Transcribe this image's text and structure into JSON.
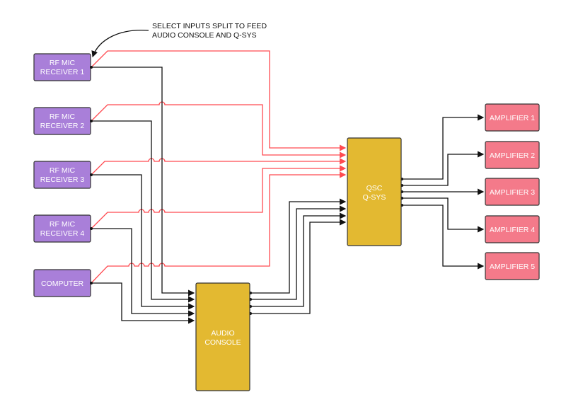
{
  "annotation": {
    "line1": "SELECT INPUTS SPLIT TO FEED",
    "line2": "AUDIO CONSOLE AND Q-SYS"
  },
  "sources": [
    {
      "line1": "RF MIC",
      "line2": "RECEIVER 1"
    },
    {
      "line1": "RF MIC",
      "line2": "RECEIVER 2"
    },
    {
      "line1": "RF MIC",
      "line2": "RECEIVER 3"
    },
    {
      "line1": "RF MIC",
      "line2": "RECEIVER 4"
    },
    {
      "line1": "COMPUTER"
    }
  ],
  "audio_console": {
    "line1": "AUDIO",
    "line2": "CONSOLE"
  },
  "qsys": {
    "line1": "QSC",
    "line2": "Q-SYS"
  },
  "amplifiers": [
    {
      "label": "AMPLIFIER 1"
    },
    {
      "label": "AMPLIFIER 2"
    },
    {
      "label": "AMPLIFIER 3"
    },
    {
      "label": "AMPLIFIER 4"
    },
    {
      "label": "AMPLIFIER 5"
    }
  ],
  "colors": {
    "source_fill": "#a97fd9",
    "processor_fill": "#e3b931",
    "amplifier_fill": "#f47a8a",
    "split_wire": "#ff4a50",
    "signal_wire": "#111111"
  }
}
